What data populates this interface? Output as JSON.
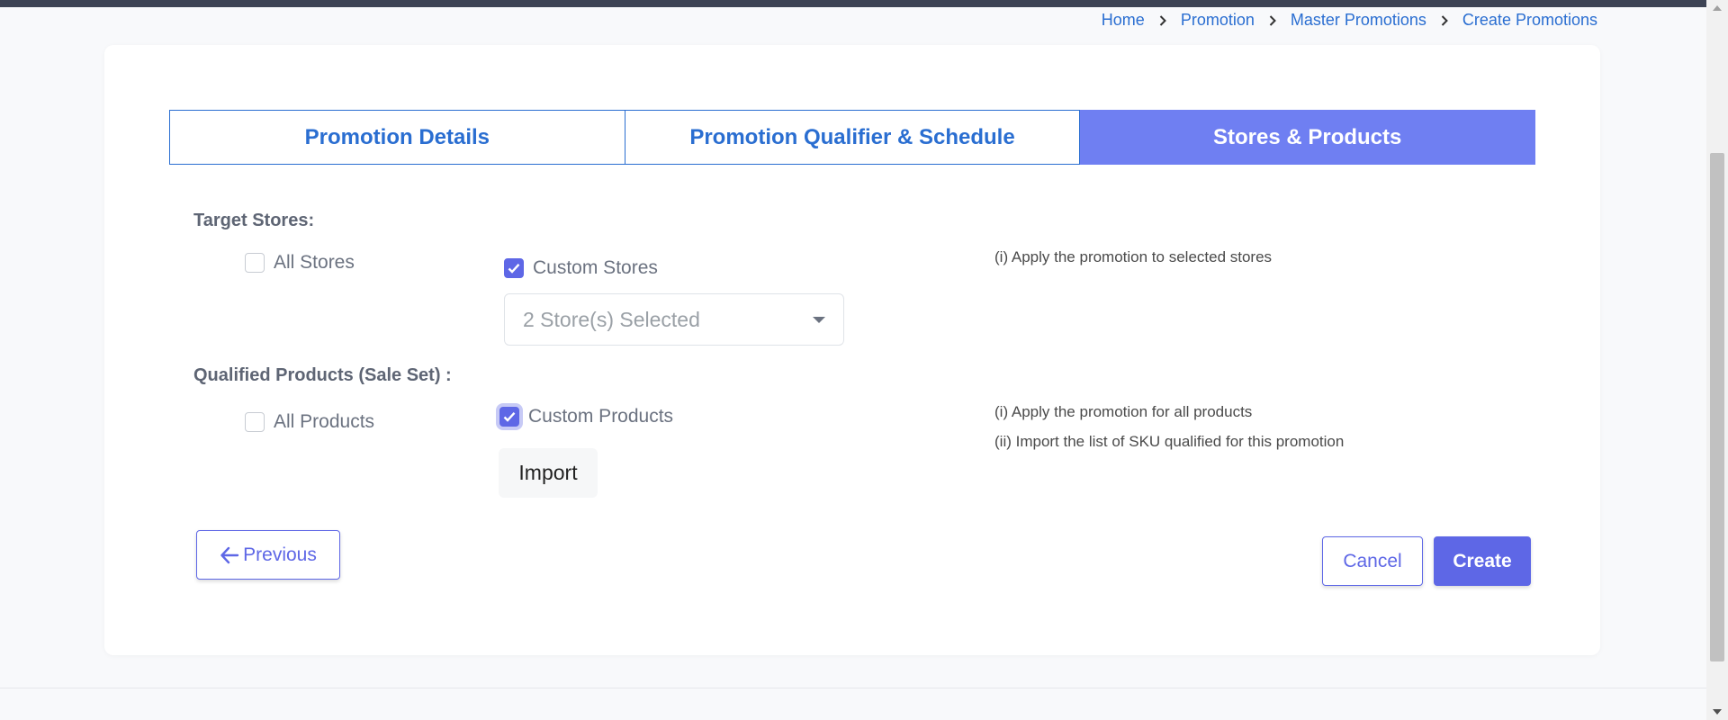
{
  "breadcrumb": [
    "Home",
    "Promotion",
    "Master Promotions",
    "Create Promotions"
  ],
  "tabs": [
    {
      "label": "Promotion Details",
      "active": false
    },
    {
      "label": "Promotion Qualifier & Schedule",
      "active": false
    },
    {
      "label": "Stores & Products",
      "active": true
    }
  ],
  "target_stores": {
    "title": "Target Stores:",
    "all_label": "All Stores",
    "all_checked": false,
    "custom_label": "Custom Stores",
    "custom_checked": true,
    "select_value": "2 Store(s) Selected",
    "hint": "(i) Apply the promotion to selected stores"
  },
  "qualified_products": {
    "title": "Qualified Products (Sale Set) :",
    "all_label": "All Products",
    "all_checked": false,
    "custom_label": "Custom Products",
    "custom_checked": true,
    "import_label": "Import",
    "hint1": "(i) Apply the promotion for all products",
    "hint2": "(ii) Import the list of SKU qualified for this promotion"
  },
  "actions": {
    "previous": "Previous",
    "cancel": "Cancel",
    "create": "Create"
  },
  "colors": {
    "accent": "#5e67e6",
    "tab_active": "#6f7ff2",
    "link": "#2a6ed1",
    "topbar": "#3d4354"
  }
}
